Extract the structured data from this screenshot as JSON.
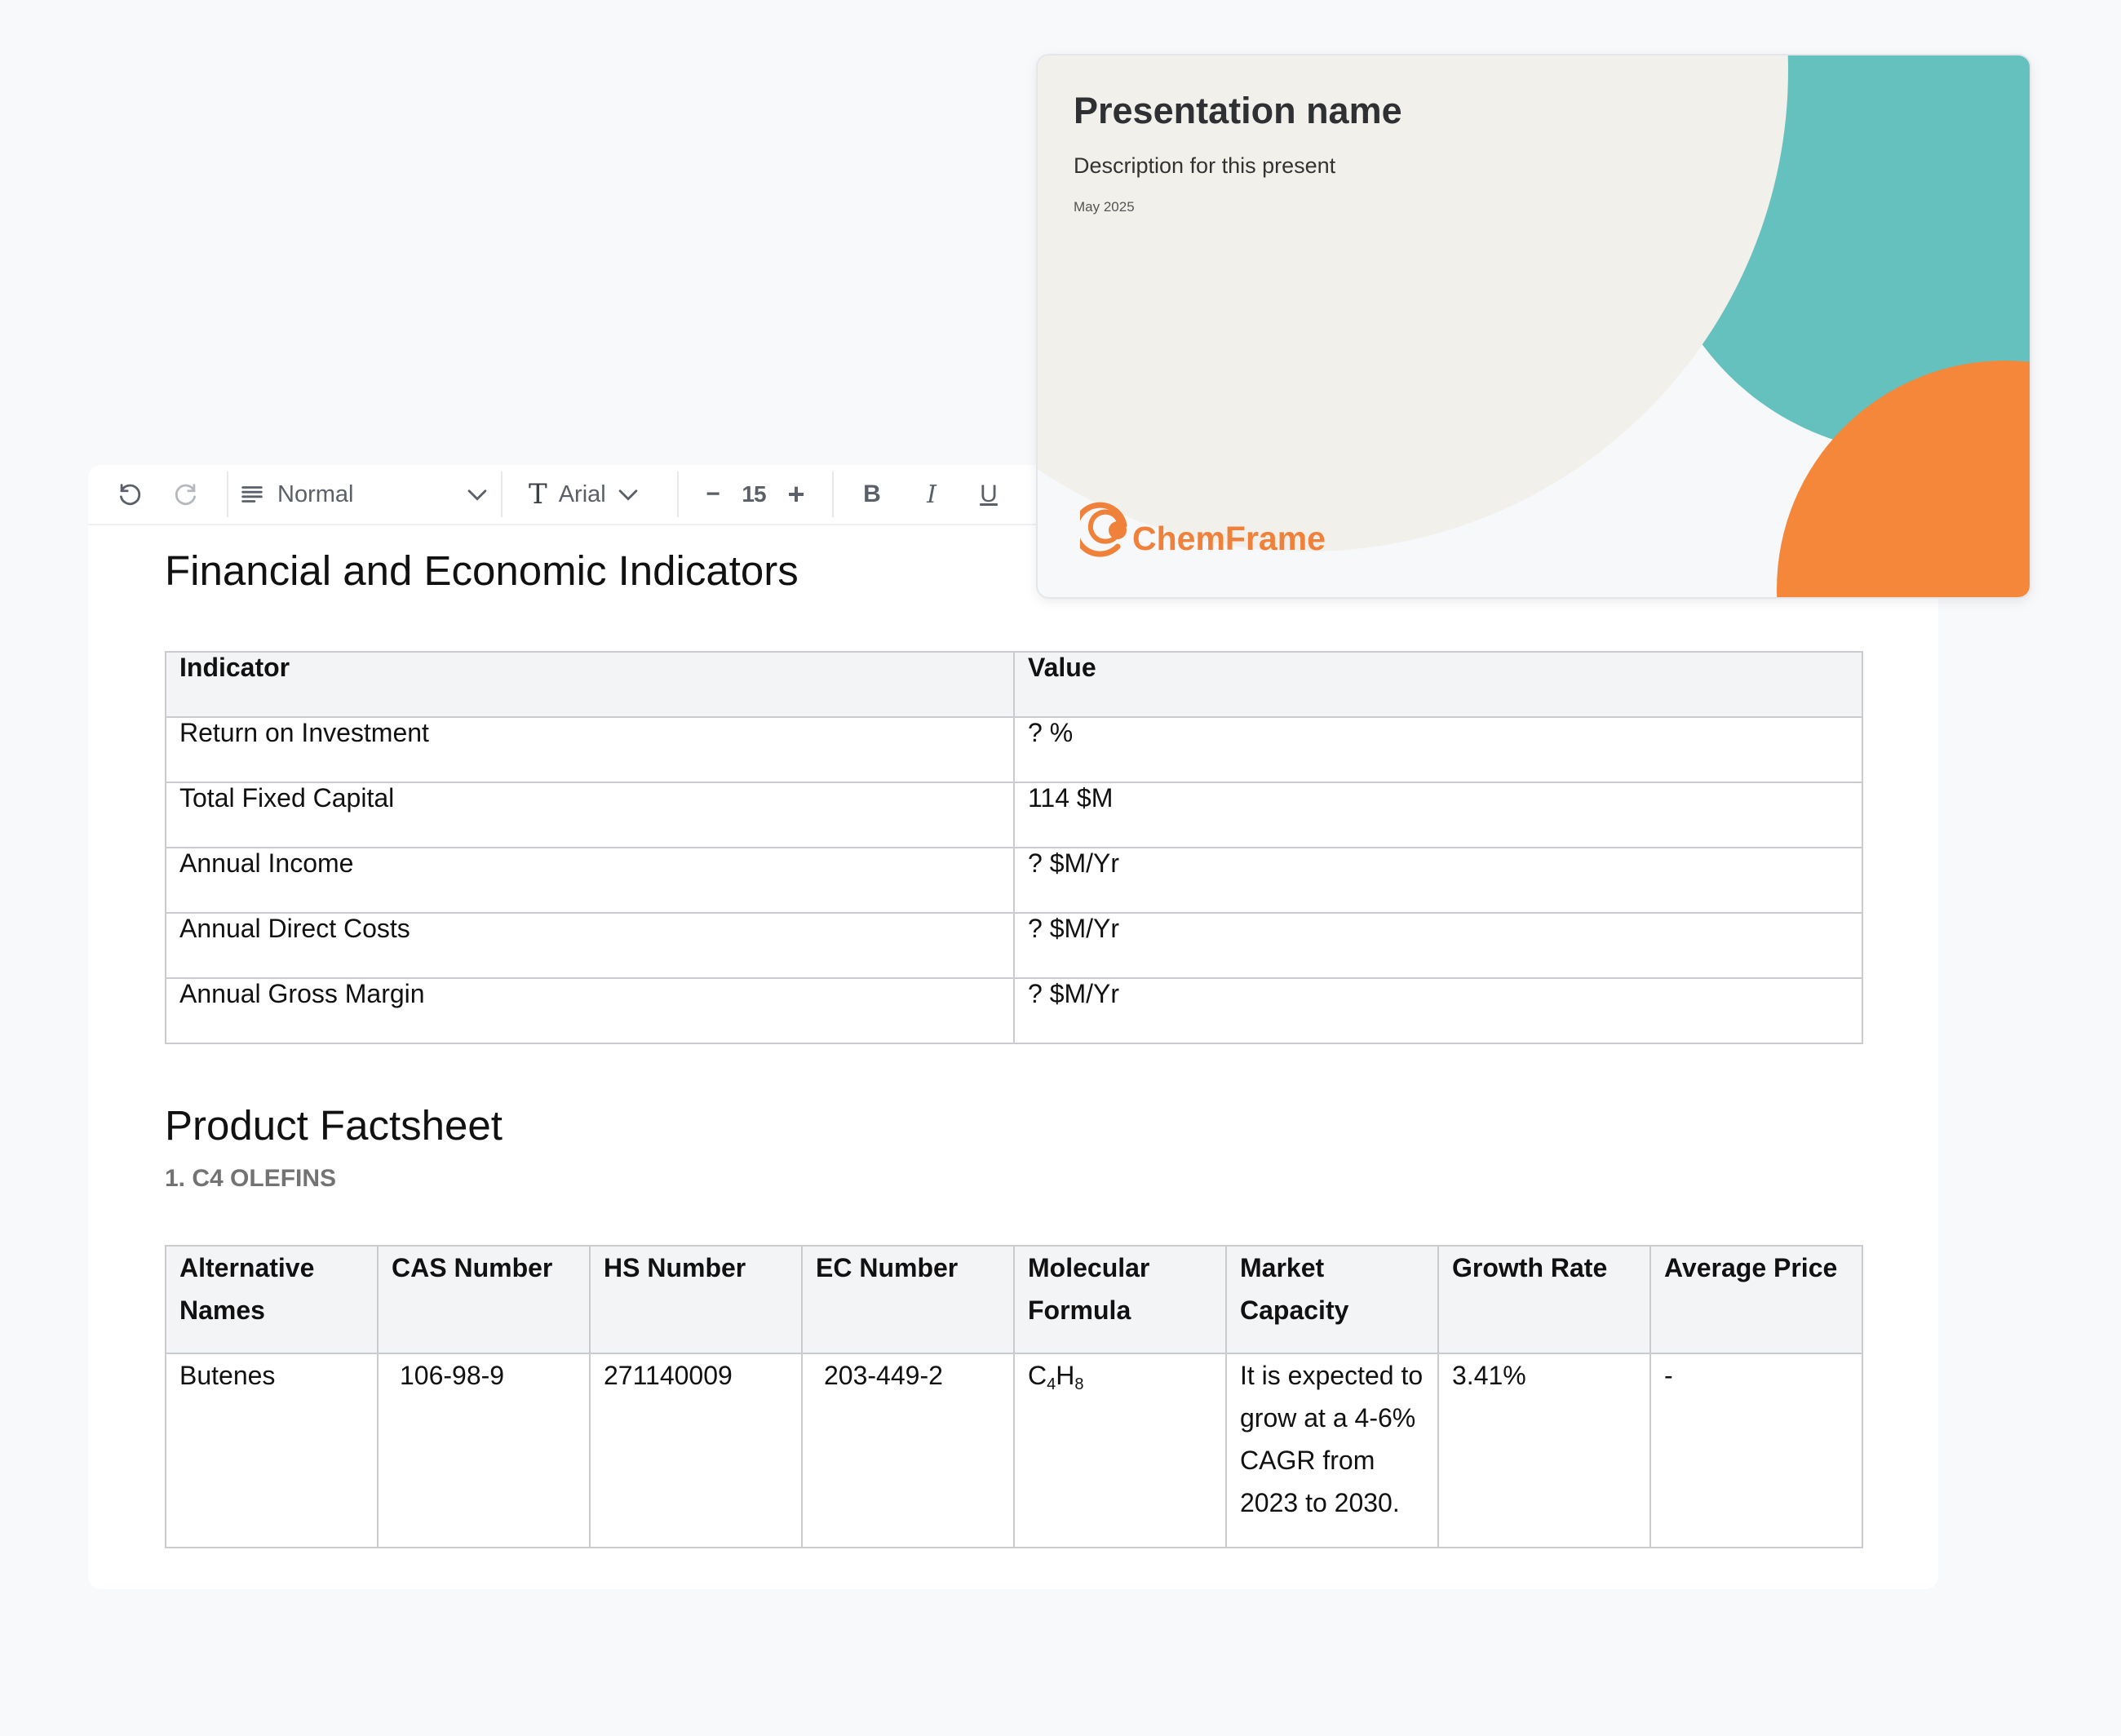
{
  "toolbar": {
    "undo_icon": "undo-icon",
    "redo_icon": "redo-icon",
    "paragraph_style": "Normal",
    "font_family": "Arial",
    "font_size": "15",
    "decrease_label": "−",
    "increase_label": "+",
    "bold_label": "B",
    "italic_label": "I",
    "underline_label": "U"
  },
  "document": {
    "section1_title": "Financial and Economic Indicators",
    "indicators_table": {
      "headers": [
        "Indicator",
        "Value"
      ],
      "rows": [
        [
          "Return on Investment",
          "? %"
        ],
        [
          "Total Fixed Capital",
          "114 $M"
        ],
        [
          "Annual Income",
          "? $M/Yr"
        ],
        [
          "Annual Direct Costs",
          "? $M/Yr"
        ],
        [
          "Annual Gross Margin",
          "? $M/Yr"
        ]
      ]
    },
    "section2_title": "Product Factsheet",
    "product_heading": "1. C4 OLEFINS",
    "factsheet_table": {
      "headers": [
        "Alternative Names",
        "CAS Number",
        "HS Number",
        "EC Number",
        "Molecular Formula",
        "Market Capacity",
        "Growth Rate",
        "Average Price"
      ],
      "row": {
        "alternative_names": "Butenes",
        "cas_number": "106-98-9",
        "hs_number": "271140009",
        "ec_number": "203-449-2",
        "formula_c": "C",
        "formula_c_sub": "4",
        "formula_h": "H",
        "formula_h_sub": "8",
        "market_capacity": "It is expected to grow at a 4-6% CAGR from 2023 to 2030.",
        "growth_rate": "3.41%",
        "average_price": "-"
      }
    }
  },
  "preview": {
    "title": "Presentation name",
    "description": "Description for this present",
    "date": "May 2025",
    "logo_text": "ChemFrame",
    "colors": {
      "beige": "#f1f0eb",
      "teal": "#65c1be",
      "orange": "#f5873a",
      "logo": "#f0813a"
    }
  }
}
